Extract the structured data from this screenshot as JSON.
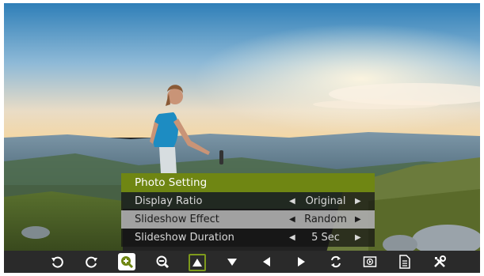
{
  "menu": {
    "title": "Photo Setting",
    "rows": [
      {
        "label": "Display Ratio",
        "value": "Original",
        "selected": false
      },
      {
        "label": "Slideshow Effect",
        "value": "Random",
        "selected": true
      },
      {
        "label": "Slideshow Duration",
        "value": "5 Sec",
        "selected": false
      }
    ],
    "arrow_left": "◀",
    "arrow_right": "▶"
  },
  "toolbar": {
    "buttons": [
      {
        "name": "rotate-left-button",
        "icon": "rotate-ccw-icon"
      },
      {
        "name": "rotate-right-button",
        "icon": "rotate-cw-icon"
      },
      {
        "name": "zoom-in-button",
        "icon": "zoom-in-icon",
        "state": "active"
      },
      {
        "name": "zoom-out-button",
        "icon": "zoom-out-icon"
      },
      {
        "name": "pan-up-button",
        "icon": "triangle-up-icon",
        "state": "focused"
      },
      {
        "name": "pan-down-button",
        "icon": "triangle-down-icon"
      },
      {
        "name": "pan-left-button",
        "icon": "triangle-left-icon"
      },
      {
        "name": "pan-right-button",
        "icon": "triangle-right-icon"
      },
      {
        "name": "repeat-button",
        "icon": "repeat-icon"
      },
      {
        "name": "slideshow-button",
        "icon": "play-box-icon"
      },
      {
        "name": "info-button",
        "icon": "document-icon"
      },
      {
        "name": "settings-button",
        "icon": "tools-icon"
      }
    ]
  },
  "colors": {
    "accent": "#6f8613",
    "toolbar_bg": "#2a2a2a",
    "menu_bg": "rgba(20,20,20,0.72)",
    "selected_row_bg": "#c8c8c8"
  }
}
